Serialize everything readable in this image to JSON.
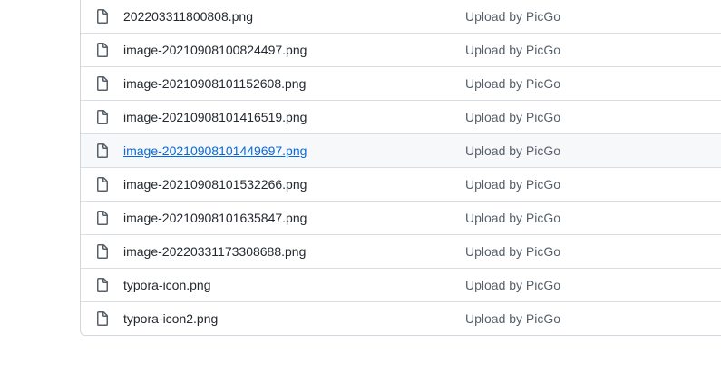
{
  "files": [
    {
      "name": "202203311800808.png",
      "commit_message": "Upload by PicGo",
      "icon": "file-icon"
    },
    {
      "name": "image-20210908100824497.png",
      "commit_message": "Upload by PicGo",
      "icon": "file-icon"
    },
    {
      "name": "image-20210908101152608.png",
      "commit_message": "Upload by PicGo",
      "icon": "file-icon"
    },
    {
      "name": "image-20210908101416519.png",
      "commit_message": "Upload by PicGo",
      "icon": "file-icon"
    },
    {
      "name": "image-20210908101449697.png",
      "commit_message": "Upload by PicGo",
      "icon": "file-icon",
      "hovered": true
    },
    {
      "name": "image-20210908101532266.png",
      "commit_message": "Upload by PicGo",
      "icon": "file-icon"
    },
    {
      "name": "image-20210908101635847.png",
      "commit_message": "Upload by PicGo",
      "icon": "file-icon"
    },
    {
      "name": "image-20220331173308688.png",
      "commit_message": "Upload by PicGo",
      "icon": "file-icon"
    },
    {
      "name": "typora-icon.png",
      "commit_message": "Upload by PicGo",
      "icon": "file-icon"
    },
    {
      "name": "typora-icon2.png",
      "commit_message": "Upload by PicGo",
      "icon": "file-icon"
    }
  ],
  "colors": {
    "link": "#0969da",
    "text": "#24292f",
    "muted": "#57606a",
    "border": "#d0d7de",
    "hover_bg": "#f6f8fa"
  }
}
